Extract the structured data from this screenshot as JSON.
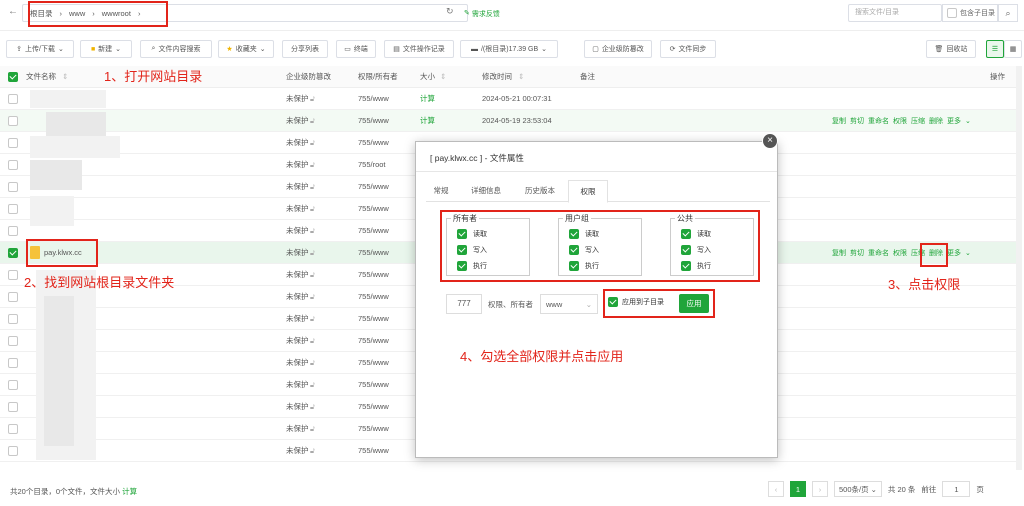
{
  "breadcrumb": {
    "items": [
      "根目录",
      "www",
      "wwwroot"
    ]
  },
  "header": {
    "feedback": "需求反馈",
    "search_placeholder": "搜索文件/目录",
    "include_sub": "包含子目录"
  },
  "toolbar": {
    "upload": "上传/下载",
    "new": "新建",
    "content_search": "文件内容搜索",
    "favorites": "收藏夹",
    "share_list": "分享列表",
    "terminal": "终端",
    "op_log": "文件操作记录",
    "disk": "/(根目录)17.39 GB",
    "tamper": "企业级防篡改",
    "file_sync": "文件同步",
    "recycle": "回收站"
  },
  "table": {
    "headers": {
      "name": "文件名称",
      "protect": "企业级防篡改",
      "perm": "权限/所有者",
      "size": "大小",
      "mtime": "修改时间",
      "note": "备注",
      "ops": "操作"
    },
    "rows": [
      {
        "name": "",
        "protect": "未保护",
        "perm": "755/www",
        "size": "计算",
        "mtime": "2024-05-21 00:07:31",
        "checked": false
      },
      {
        "name": "",
        "protect": "未保护",
        "perm": "755/www",
        "size": "计算",
        "mtime": "2024-05-19 23:53:04",
        "checked": false
      },
      {
        "name": "",
        "protect": "未保护",
        "perm": "755/www",
        "size": "",
        "mtime": "",
        "checked": false
      },
      {
        "name": "",
        "protect": "未保护",
        "perm": "755/root",
        "size": "",
        "mtime": "",
        "checked": false
      },
      {
        "name": "",
        "protect": "未保护",
        "perm": "755/www",
        "size": "",
        "mtime": "",
        "checked": false
      },
      {
        "name": "",
        "protect": "未保护",
        "perm": "755/www",
        "size": "",
        "mtime": "",
        "checked": false
      },
      {
        "name": "",
        "protect": "未保护",
        "perm": "755/www",
        "size": "",
        "mtime": "",
        "checked": false
      },
      {
        "name": "pay.klwx.cc",
        "protect": "未保护",
        "perm": "755/www",
        "size": "",
        "mtime": "",
        "checked": true
      },
      {
        "name": "",
        "protect": "未保护",
        "perm": "755/www",
        "size": "",
        "mtime": "",
        "checked": false
      },
      {
        "name": "",
        "protect": "未保护",
        "perm": "755/www",
        "size": "",
        "mtime": "",
        "checked": false
      },
      {
        "name": "",
        "protect": "未保护",
        "perm": "755/www",
        "size": "",
        "mtime": "",
        "checked": false
      },
      {
        "name": "",
        "protect": "未保护",
        "perm": "755/www",
        "size": "",
        "mtime": "",
        "checked": false
      },
      {
        "name": "",
        "protect": "未保护",
        "perm": "755/www",
        "size": "",
        "mtime": "",
        "checked": false
      },
      {
        "name": "",
        "protect": "未保护",
        "perm": "755/www",
        "size": "",
        "mtime": "",
        "checked": false
      },
      {
        "name": "",
        "protect": "未保护",
        "perm": "755/www",
        "size": "",
        "mtime": "",
        "checked": false
      },
      {
        "name": "",
        "protect": "未保护",
        "perm": "755/www",
        "size": "",
        "mtime": "",
        "checked": false
      },
      {
        "name": "",
        "protect": "未保护",
        "perm": "755/www",
        "size": "",
        "mtime": "",
        "checked": false
      }
    ],
    "row_ops": [
      "复制",
      "剪切",
      "重命名",
      "权限",
      "压缩",
      "删除",
      "更多"
    ]
  },
  "footer": {
    "summary": "共20个目录，0个文件，文件大小",
    "calc": "计算",
    "page": "1",
    "per_page": "500条/页",
    "total": "共 20 条",
    "goto_label": "前往",
    "goto_value": "1",
    "page_unit": "页"
  },
  "dialog": {
    "title": "[ pay.klwx.cc ] - 文件属性",
    "tabs": [
      "常规",
      "详细信息",
      "历史版本",
      "权限"
    ],
    "groups": [
      {
        "name": "所有者",
        "perms": [
          "读取",
          "写入",
          "执行"
        ]
      },
      {
        "name": "用户组",
        "perms": [
          "读取",
          "写入",
          "执行"
        ]
      },
      {
        "name": "公共",
        "perms": [
          "读取",
          "写入",
          "执行"
        ]
      }
    ],
    "perm_value": "777",
    "perm_owner_label": "权限、所有者",
    "owner_value": "www",
    "apply_sub": "应用到子目录",
    "apply_button": "应用"
  },
  "annotations": {
    "step1": "1、打开网站目录",
    "step2": "2、找到网站根目录文件夹",
    "step3": "3、点击权限",
    "step4": "4、勾选全部权限并点击应用"
  },
  "colors": {
    "accent": "#20a53a",
    "annotation": "#e2241a"
  }
}
